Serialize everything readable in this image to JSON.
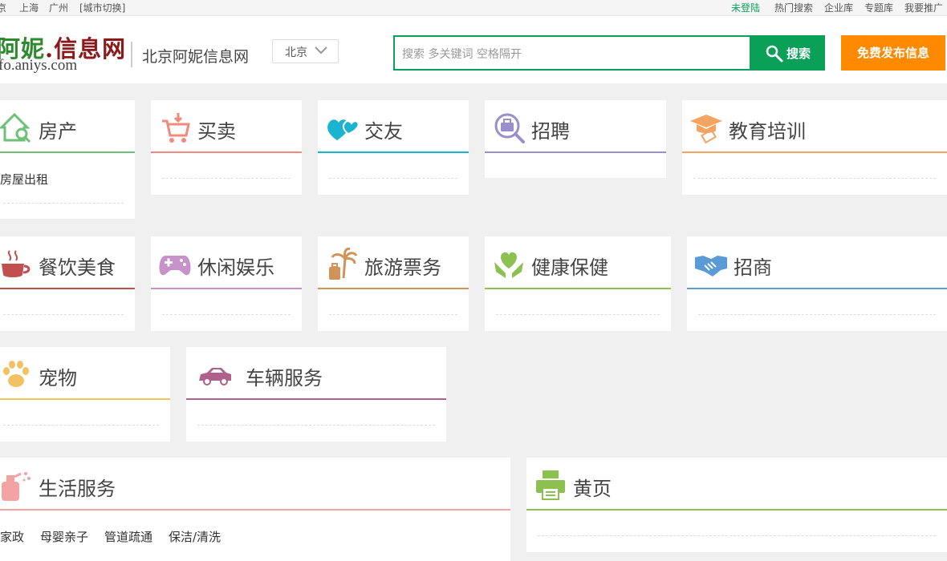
{
  "topbar": {
    "cities": [
      "京",
      "上海",
      "广州",
      "[城市切换]"
    ],
    "links": [
      "未登陆",
      "热门搜索",
      "企业库",
      "专题库",
      "我要推广"
    ]
  },
  "header": {
    "logo_title_green": "阿妮",
    "logo_title_red": ".信息网",
    "logo_domain": "fo.aniys.com",
    "site_name": "北京阿妮信息网",
    "city_select": "北京",
    "search_placeholder": "搜索 多关键词 空格隔开",
    "search_button": "搜索",
    "publish_button": "免费发布信息"
  },
  "categories": [
    {
      "title": "房产",
      "icon": "house-search-icon",
      "color": "#6dc077",
      "items": [
        "房屋出租"
      ]
    },
    {
      "title": "买卖",
      "icon": "shopping-cart-icon",
      "color": "#f08a7e",
      "items": []
    },
    {
      "title": "交友",
      "icon": "hearts-icon",
      "color": "#1ab4d0",
      "items": []
    },
    {
      "title": "招聘",
      "icon": "briefcase-search-icon",
      "color": "#9b8fcb",
      "items": []
    },
    {
      "title": "教育培训",
      "icon": "graduation-cap-icon",
      "color": "#f4a460",
      "items": []
    },
    {
      "title": "餐饮美食",
      "icon": "coffee-cup-icon",
      "color": "#c0504d",
      "items": []
    },
    {
      "title": "休闲娱乐",
      "icon": "gamepad-icon",
      "color": "#c792c9",
      "items": []
    },
    {
      "title": "旅游票务",
      "icon": "palm-luggage-icon",
      "color": "#d2935a",
      "items": []
    },
    {
      "title": "健康保健",
      "icon": "heart-hands-icon",
      "color": "#8cc152",
      "items": []
    },
    {
      "title": "招商",
      "icon": "handshake-icon",
      "color": "#5a9bd5",
      "items": []
    },
    {
      "title": "宠物",
      "icon": "paw-icon",
      "color": "#f2c162",
      "items": []
    },
    {
      "title": "车辆服务",
      "icon": "car-icon",
      "color": "#b0608c",
      "items": []
    },
    {
      "title": "生活服务",
      "icon": "cleaning-spray-icon",
      "color": "#f4a3a3",
      "items": [
        "家政",
        "母婴亲子",
        "管道疏通",
        "保洁/清洗"
      ]
    },
    {
      "title": "黄页",
      "icon": "printer-icon",
      "color": "#8cc152",
      "items": []
    }
  ]
}
